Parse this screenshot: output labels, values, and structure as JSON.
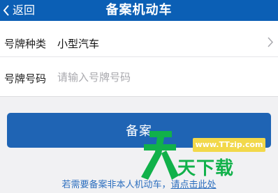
{
  "nav": {
    "back_label": "返回",
    "title": "备案机动车"
  },
  "form": {
    "plate_type": {
      "label": "号牌种类",
      "value": "小型汽车"
    },
    "plate_number": {
      "label": "号牌号码",
      "placeholder": "请输入号牌号码",
      "value": ""
    }
  },
  "submit_label": "备案",
  "footer": {
    "note": "若需要备案非本人机动车，",
    "link": "请点击此处"
  },
  "watermark": {
    "url": "www.TTzip.com",
    "text": "天下载"
  },
  "colors": {
    "header": "#0b5fb5",
    "button": "#1f64b4",
    "link": "#2d6fbf",
    "watermark_green": "#11b14a",
    "watermark_yellow": "#f2d84a"
  },
  "icons": {
    "back": "chevron-left-icon",
    "row_arrow": "chevron-right-icon"
  }
}
